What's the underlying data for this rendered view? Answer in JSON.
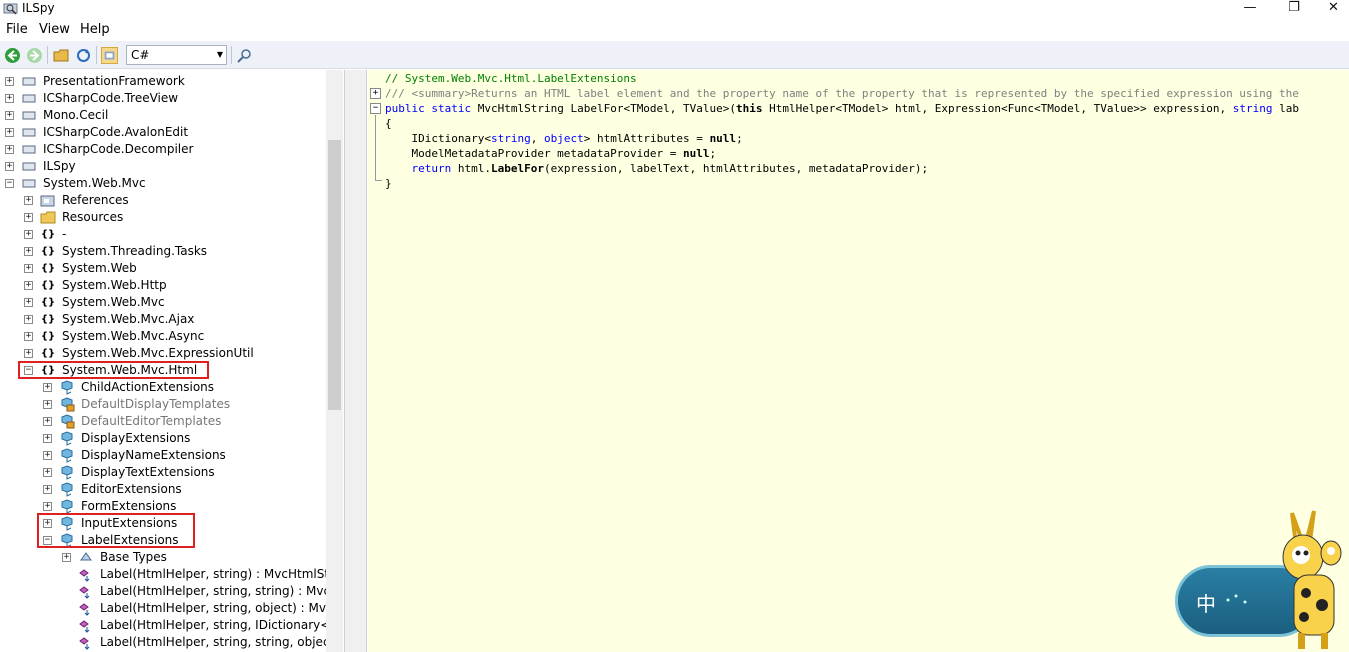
{
  "window": {
    "title": "ILSpy",
    "controls": {
      "minimize": "—",
      "maximize": "❐",
      "close": "✕"
    }
  },
  "menu": [
    "File",
    "View",
    "Help"
  ],
  "toolbar": {
    "language": "C#",
    "icons": [
      "back-icon",
      "forward-icon",
      "open-icon",
      "reload-icon",
      "show-internal-icon",
      "search-icon"
    ]
  },
  "tree": {
    "top_nodes": [
      {
        "label": "PresentationFramework",
        "icon": "assembly-icon"
      },
      {
        "label": "ICSharpCode.TreeView",
        "icon": "assembly-icon"
      },
      {
        "label": "Mono.Cecil",
        "icon": "assembly-icon"
      },
      {
        "label": "ICSharpCode.AvalonEdit",
        "icon": "assembly-icon"
      },
      {
        "label": "ICSharpCode.Decompiler",
        "icon": "assembly-icon"
      },
      {
        "label": "ILSpy",
        "icon": "assembly-icon"
      },
      {
        "label": "System.Web.Mvc",
        "icon": "assembly-icon"
      }
    ],
    "assembly_children": [
      {
        "label": "References",
        "icon": "references-icon"
      },
      {
        "label": "Resources",
        "icon": "folder-icon"
      },
      {
        "label": "-",
        "icon": "namespace-icon"
      },
      {
        "label": "System.Threading.Tasks",
        "icon": "namespace-icon"
      },
      {
        "label": "System.Web",
        "icon": "namespace-icon"
      },
      {
        "label": "System.Web.Http",
        "icon": "namespace-icon"
      },
      {
        "label": "System.Web.Mvc",
        "icon": "namespace-icon"
      },
      {
        "label": "System.Web.Mvc.Ajax",
        "icon": "namespace-icon"
      },
      {
        "label": "System.Web.Mvc.Async",
        "icon": "namespace-icon"
      },
      {
        "label": "System.Web.Mvc.ExpressionUtil",
        "icon": "namespace-icon"
      },
      {
        "label": "System.Web.Mvc.Html",
        "icon": "namespace-icon"
      }
    ],
    "classes": [
      {
        "label": "ChildActionExtensions",
        "dim": false
      },
      {
        "label": "DefaultDisplayTemplates",
        "dim": true
      },
      {
        "label": "DefaultEditorTemplates",
        "dim": true
      },
      {
        "label": "DisplayExtensions",
        "dim": false
      },
      {
        "label": "DisplayNameExtensions",
        "dim": false
      },
      {
        "label": "DisplayTextExtensions",
        "dim": false
      },
      {
        "label": "EditorExtensions",
        "dim": false
      },
      {
        "label": "FormExtensions",
        "dim": false
      },
      {
        "label": "InputExtensions",
        "dim": false
      },
      {
        "label": "LabelExtensions",
        "dim": false
      }
    ],
    "label_ext_children": [
      {
        "label": "Base Types",
        "icon": "base-types-icon"
      },
      {
        "label": "Label(HtmlHelper, string) : MvcHtmlStri",
        "icon": "method-icon"
      },
      {
        "label": "Label(HtmlHelper, string, string) : MvcH",
        "icon": "method-icon"
      },
      {
        "label": "Label(HtmlHelper, string, object) : MvcH",
        "icon": "method-icon"
      },
      {
        "label": "Label(HtmlHelper, string, IDictionary<s",
        "icon": "method-icon"
      },
      {
        "label": "Label(HtmlHelper, string, string, object)",
        "icon": "method-icon"
      }
    ]
  },
  "code": {
    "line1": "// System.Web.Mvc.Html.LabelExtensions",
    "line2": "/// <summary>Returns an HTML label element and the property name of the property that is represented by the specified expression using the",
    "line3_kw1": "public",
    "line3_kw2": "static",
    "line3_a": " MvcHtmlString LabelFor<TModel, TValue>(",
    "line3_kw3": "this",
    "line3_b": " HtmlHelper<TModel> html, Expression<Func<TModel, TValue>> expression, ",
    "line3_kw4": "string",
    "line3_c": " lab",
    "line4": "{",
    "line5_a": "    IDictionary<",
    "line5_kw1": "string",
    "line5_b": ", ",
    "line5_kw2": "object",
    "line5_c": "> htmlAttributes = ",
    "line5_kw3": "null",
    "line5_d": ";",
    "line6_a": "    ModelMetadataProvider metadataProvider = ",
    "line6_kw": "null",
    "line6_b": ";",
    "line7_kw": "    return",
    "line7_a": " html.",
    "line7_b": "LabelFor",
    "line7_c": "(expression, labelText, htmlAttributes, metadataProvider);",
    "line8": "}"
  },
  "ime": {
    "char": "中"
  }
}
